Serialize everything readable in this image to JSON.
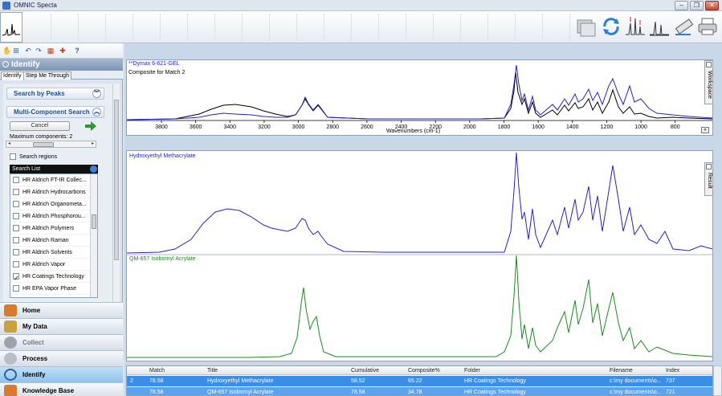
{
  "window": {
    "title": "OMNIC Specta",
    "minimize": "–",
    "maximize": "❐",
    "close": "✕"
  },
  "sidebar": {
    "header": "Identify",
    "tabs": [
      {
        "label": "Identify",
        "active": true
      },
      {
        "label": "Step Me Through",
        "active": false
      }
    ],
    "search_by_peaks": "Search by Peaks",
    "multi_component": "Multi-Component Search",
    "cancel": "Cancel",
    "max_components_label": "Maximum components:",
    "max_components_value": "2",
    "search_regions": "Search regions",
    "search_list_title": "Search List",
    "search_list": [
      {
        "label": "HR Aldrich FT-IR Collec...",
        "checked": false
      },
      {
        "label": "HR Aldrich Hydrocarbons",
        "checked": false
      },
      {
        "label": "HR Aldrich Organometa...",
        "checked": false
      },
      {
        "label": "HR Aldrich Phosphorou...",
        "checked": false
      },
      {
        "label": "HR Aldrich Polymers",
        "checked": false
      },
      {
        "label": "HR Aldrich Raman",
        "checked": false
      },
      {
        "label": "HR Aldrich Solvents",
        "checked": false
      },
      {
        "label": "HR Aldrich Vapor",
        "checked": false
      },
      {
        "label": "HR Coatings Technology",
        "checked": true
      },
      {
        "label": "HR EPA Vapor Phase",
        "checked": false
      }
    ],
    "nav": [
      {
        "label": "Home",
        "state": "normal"
      },
      {
        "label": "My Data",
        "state": "normal"
      },
      {
        "label": "Collect",
        "state": "disabled"
      },
      {
        "label": "Process",
        "state": "normal"
      },
      {
        "label": "Identify",
        "state": "active"
      },
      {
        "label": "Knowledge Base",
        "state": "normal"
      }
    ]
  },
  "workspace": {
    "sample_name": "**Dymax 6-621-GEL",
    "composite_label": "Composite for Match 2",
    "side_tab": "Workspace",
    "xlabel": "Wavenumbers (cm-1)",
    "ticks": [
      "3800",
      "3600",
      "3400",
      "3200",
      "3000",
      "2800",
      "2600",
      "2400",
      "2200",
      "2000",
      "1800",
      "1600",
      "1400",
      "1200",
      "1000",
      "800"
    ]
  },
  "result": {
    "side_tab": "Result",
    "spectrum1": "Hydroxyethyl Methacrylate",
    "spectrum2": "QM-657 Isobornyl Acrylate"
  },
  "results_table": {
    "headers": {
      "match": "Match",
      "title": "Title",
      "cumulative": "Cumulative",
      "composite": "Composite%",
      "folder": "Folder",
      "filename": "Filename",
      "index": "Index"
    },
    "rows": [
      {
        "num": "2",
        "match": "78.58",
        "title": "Hydroxyethyl Methacrylate",
        "cumulative": "58.52",
        "composite": "65.22",
        "folder": "HR Coatings Technology",
        "filename": "c:\\my documents\\o...",
        "index": "737"
      },
      {
        "num": "",
        "match": "78.58",
        "title": "QM-657 Isobornyl Acrylate",
        "cumulative": "78.58",
        "composite": "34.78",
        "folder": "HR Coatings Technology",
        "filename": "c:\\my documents\\o...",
        "index": "721"
      }
    ]
  },
  "colors": {
    "sample_trace": "#000000",
    "composite_trace": "#2323d6",
    "hema_trace": "#2323d6",
    "isobornyl_trace": "#1c8c1c",
    "selection": "#3b8ee8"
  }
}
